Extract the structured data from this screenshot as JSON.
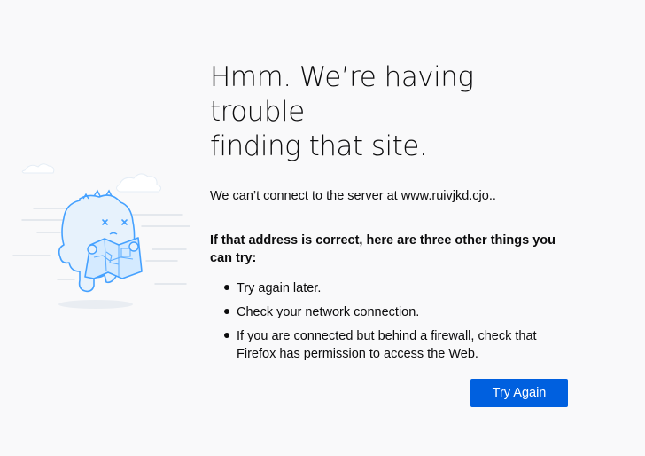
{
  "error": {
    "title_line1": "Hmm. We’re having trouble",
    "title_line2": "finding that site.",
    "description": "We can’t connect to the server at www.ruivjkd.cjo..",
    "subheading": "If that address is correct, here are three other things you can try:",
    "tips": [
      "Try again later.",
      "Check your network connection.",
      "If you are connected but behind a firewall, check that Firefox has permission to access the Web."
    ],
    "try_again_label": "Try Again"
  },
  "illustration": {
    "icon": "lost-map-creature-icon",
    "accent_color": "#45a1ff"
  },
  "colors": {
    "background": "#f9f9fa",
    "button": "#0060df",
    "text": "#0c0c0d"
  }
}
